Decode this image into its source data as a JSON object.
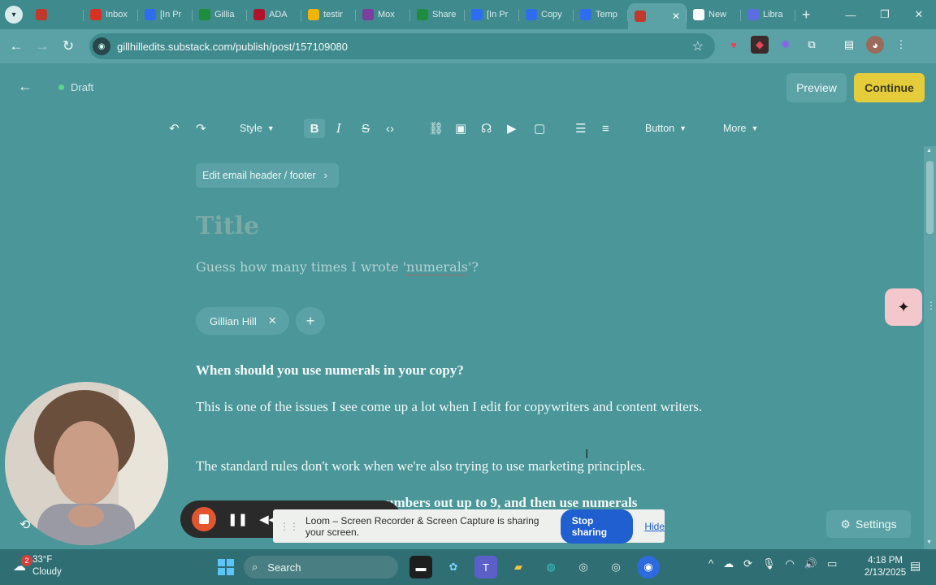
{
  "browser": {
    "tab_search_icon": "chevron-down-icon",
    "tabs": [
      {
        "label": "",
        "favicon": "#c0392b"
      },
      {
        "label": "Inbox",
        "favicon": "#d93025"
      },
      {
        "label": "[In Pr",
        "favicon": "#2f6df0"
      },
      {
        "label": "Gillia",
        "favicon": "#1e8e3e"
      },
      {
        "label": "ADA",
        "favicon": "#b3122b"
      },
      {
        "label": "testir",
        "favicon": "#f4b400"
      },
      {
        "label": "Mox",
        "favicon": "#7b3fa0"
      },
      {
        "label": "Share",
        "favicon": "#1e8e3e"
      },
      {
        "label": "[In Pr",
        "favicon": "#2f6df0"
      },
      {
        "label": "Copy",
        "favicon": "#2f6df0"
      },
      {
        "label": "Temp",
        "favicon": "#2f6df0"
      },
      {
        "label": "",
        "favicon": "#c0392b",
        "active": true
      },
      {
        "label": "New",
        "favicon": "#ffffff"
      },
      {
        "label": "Libra",
        "favicon": "#5b6ee1"
      }
    ],
    "new_tab": "+",
    "window_controls": {
      "minimize": "—",
      "restore": "❐",
      "close": "✕"
    },
    "url": "gillhilledits.substack.com/publish/post/157109080"
  },
  "editor": {
    "status": "Draft",
    "preview_label": "Preview",
    "continue_label": "Continue",
    "toolbar": {
      "style_label": "Style",
      "button_label": "Button",
      "more_label": "More"
    },
    "email_header_label": "Edit email header / footer",
    "title_placeholder": "Title",
    "subtitle_pre": "Guess how many times I wrote '",
    "subtitle_word": "numerals",
    "subtitle_post": "'?",
    "author": "Gillian Hill",
    "heading": "When should you use numerals in your copy?",
    "para1": "This is one of the issues I see come up a lot when I edit for copywriters and content writers.",
    "para2": "The standard rules don't work when we're also trying to use marketing principles.",
    "para3": "umbers out up to 9, and then use numerals"
  },
  "loom": {
    "share_message": "Loom – Screen Recorder & Screen Capture is sharing your screen.",
    "stop_label": "Stop sharing",
    "hide_label": "Hide"
  },
  "settings_label": "Settings",
  "taskbar": {
    "weather_badge": "2",
    "temperature": "33°F",
    "condition": "Cloudy",
    "search_label": "Search",
    "time": "4:18 PM",
    "date": "2/13/2025"
  }
}
